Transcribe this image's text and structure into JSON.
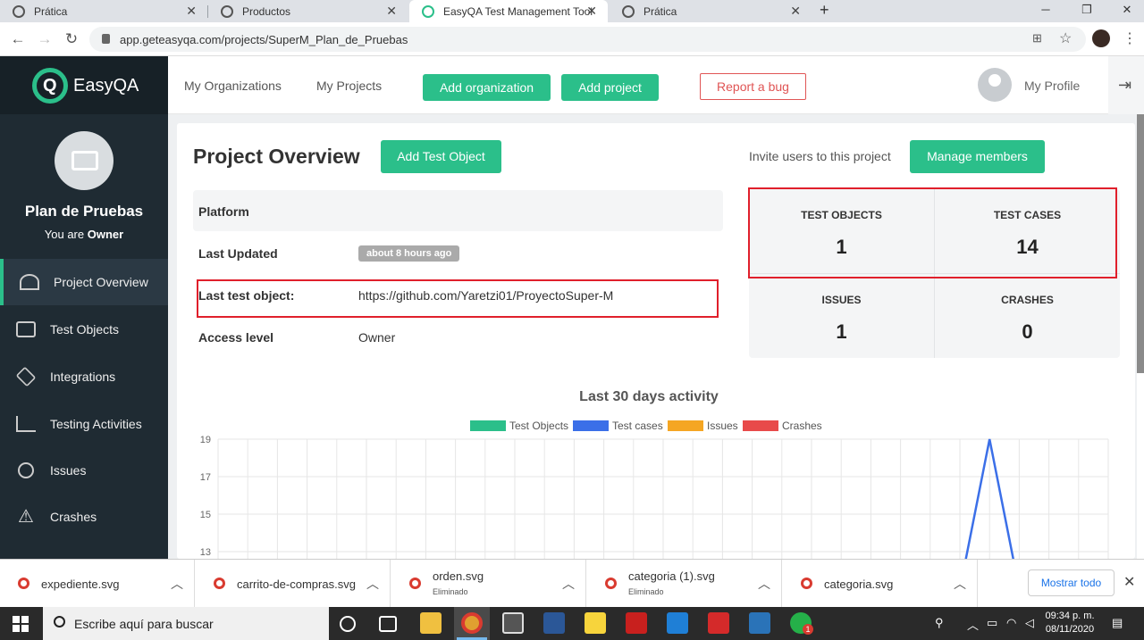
{
  "browser": {
    "tabs": [
      {
        "title": "Prática"
      },
      {
        "title": "Productos"
      },
      {
        "title": "EasyQA Test Management Tool",
        "active": true
      },
      {
        "title": "Prática"
      }
    ],
    "new_tab": "+",
    "url": "app.geteasyqa.com/projects/SuperM_Plan_de_Pruebas"
  },
  "app": {
    "logo_text": "EasyQA",
    "logo_mark": "Q",
    "nav": {
      "my_organizations": "My Organizations",
      "my_projects": "My Projects",
      "add_organization": "Add organization",
      "add_project": "Add project",
      "report_bug": "Report a bug",
      "my_profile": "My Profile"
    },
    "sidebar": {
      "project_name": "Plan de Pruebas",
      "role_prefix": "You are ",
      "role": "Owner",
      "items": [
        {
          "label": "Project Overview",
          "icon": "gauge-icon",
          "active": true
        },
        {
          "label": "Test Objects",
          "icon": "folder-icon"
        },
        {
          "label": "Integrations",
          "icon": "layers-icon"
        },
        {
          "label": "Testing Activities",
          "icon": "chart-line-icon"
        },
        {
          "label": "Issues",
          "icon": "bug-icon"
        },
        {
          "label": "Crashes",
          "icon": "warning-icon"
        }
      ]
    },
    "overview": {
      "title": "Project Overview",
      "add_test_object": "Add Test Object",
      "invite_text": "Invite users to this project",
      "manage_members": "Manage members",
      "fields": {
        "platform_label": "Platform",
        "last_updated_label": "Last Updated",
        "last_updated_value": "about 8 hours ago",
        "last_test_object_label": "Last test object:",
        "last_test_object_value": "https://github.com/Yaretzi01/ProyectoSuper-M",
        "access_level_label": "Access level",
        "access_level_value": "Owner"
      },
      "stats": [
        {
          "label": "TEST OBJECTS",
          "value": "1"
        },
        {
          "label": "TEST CASES",
          "value": "14"
        },
        {
          "label": "ISSUES",
          "value": "1"
        },
        {
          "label": "CRASHES",
          "value": "0"
        }
      ]
    }
  },
  "chart_data": {
    "type": "line",
    "title": "Last 30 days activity",
    "series": [
      {
        "name": "Test Objects",
        "color": "#2bbf8a"
      },
      {
        "name": "Test cases",
        "color": "#3b6fe8"
      },
      {
        "name": "Issues",
        "color": "#f5a623"
      },
      {
        "name": "Crashes",
        "color": "#e84a4a"
      }
    ],
    "y_ticks": [
      "19",
      "17",
      "15",
      "13"
    ],
    "visible_range": [
      12,
      19
    ],
    "test_cases_spike": {
      "index": 26,
      "value": 19,
      "of": 30
    }
  },
  "downloads": {
    "items": [
      {
        "name": "expediente.svg",
        "sub": ""
      },
      {
        "name": "carrito-de-compras.svg",
        "sub": ""
      },
      {
        "name": "orden.svg",
        "sub": "Eliminado"
      },
      {
        "name": "categoria (1).svg",
        "sub": "Eliminado"
      },
      {
        "name": "categoria.svg",
        "sub": ""
      }
    ],
    "show_all": "Mostrar todo"
  },
  "taskbar": {
    "search_placeholder": "Escribe aquí para buscar",
    "time": "09:34 p. m.",
    "date": "08/11/2020",
    "whatsapp_badge": "1"
  }
}
